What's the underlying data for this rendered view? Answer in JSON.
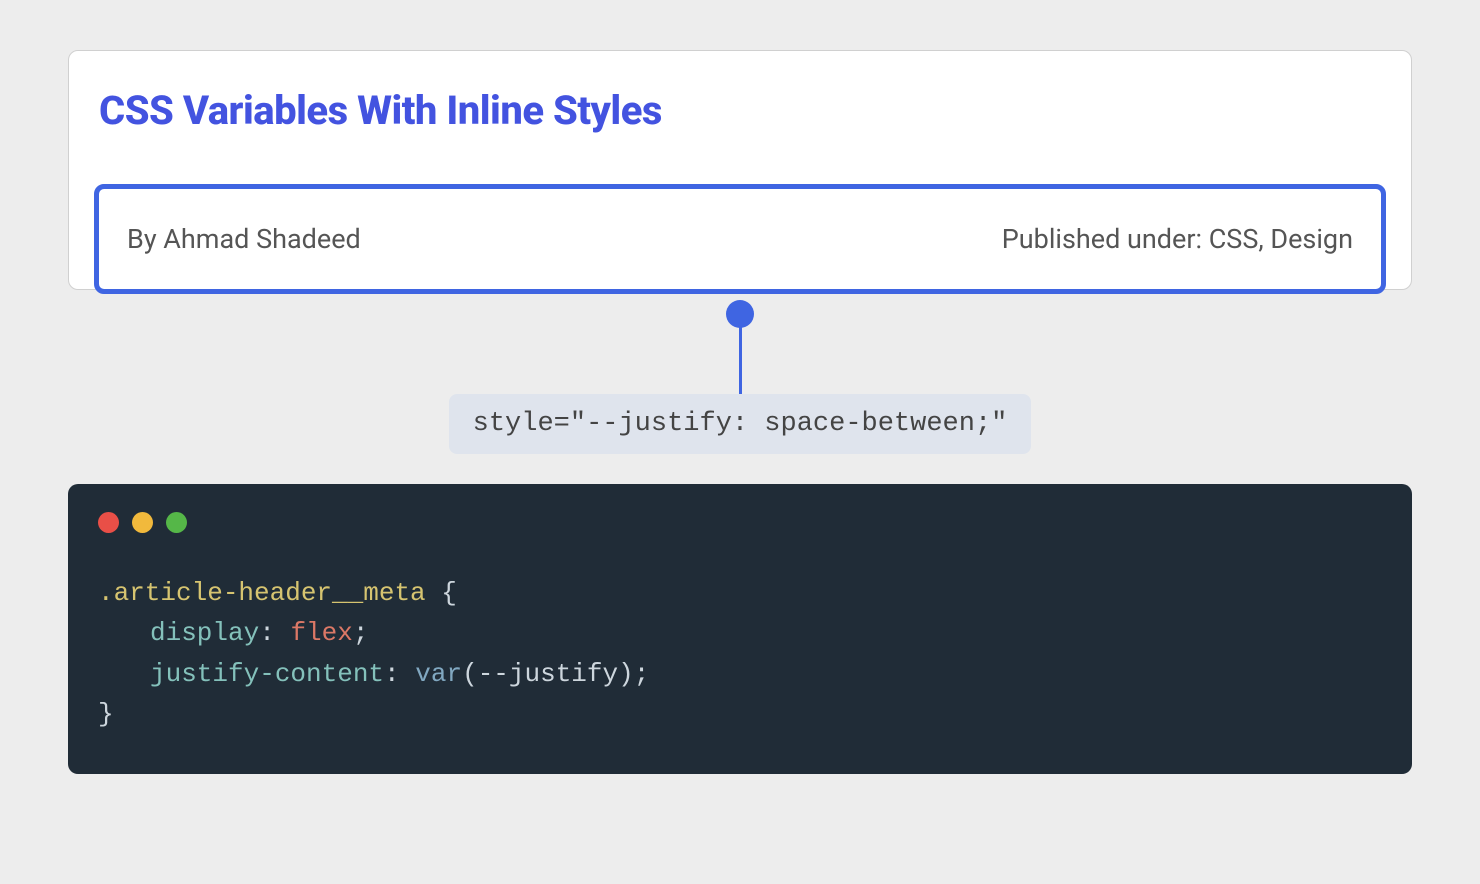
{
  "card": {
    "title": "CSS Variables With Inline Styles",
    "byline": "By Ahmad Shadeed",
    "published": "Published under: CSS, Design"
  },
  "connector": {
    "style_attr": "style=\"--justify: space-between;\""
  },
  "code": {
    "selector": ".article-header__meta",
    "brace_open": " {",
    "line1_prop": "display",
    "line1_sep": ": ",
    "line1_val": "flex",
    "line1_end": ";",
    "line2_prop": "justify-content",
    "line2_sep": ": ",
    "line2_func": "var",
    "line2_paren_open": "(",
    "line2_var": "--justify",
    "line2_paren_close": ")",
    "line2_end": ";",
    "brace_close": "}"
  }
}
